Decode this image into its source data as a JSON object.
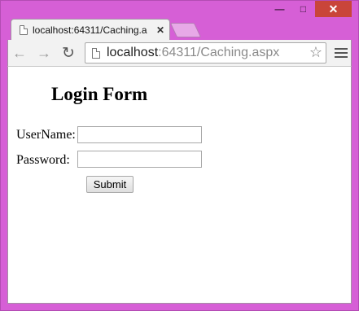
{
  "browser": {
    "tab_title": "localhost:64311/Caching.a",
    "url_host": "localhost",
    "url_rest": ":64311/Caching.aspx"
  },
  "form": {
    "title": "Login Form",
    "username_label": "UserName:",
    "username_value": "",
    "password_label": "Password:",
    "password_value": "",
    "submit_label": "Submit"
  }
}
